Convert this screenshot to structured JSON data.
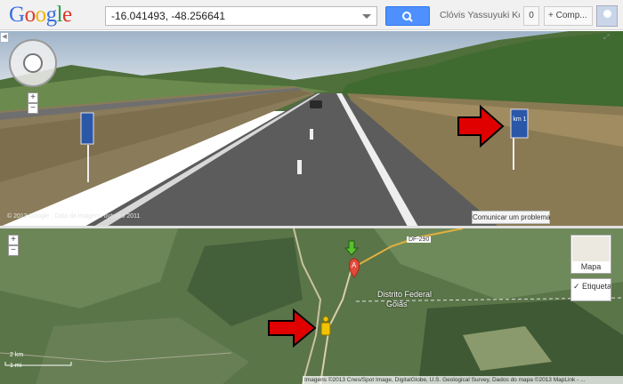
{
  "header": {
    "logo_text": "Google",
    "search_value": "-16.041493, -48.256641",
    "user_name": "Clóvis Yassuyuki Ko...",
    "notification_count": "0",
    "share_label": "+ Comp..."
  },
  "street_view": {
    "copyright": "© 2013 Google · Data da imagem: outubro 2011",
    "report_label": "Comunicar um problema",
    "sign_text": "km 1",
    "zoom_in": "+",
    "zoom_out": "−",
    "watermark": "© 2013"
  },
  "map": {
    "zoom_in": "+",
    "zoom_out": "−",
    "road_label": "DF-290",
    "marker_label": "A",
    "region_df": "Distrito Federal",
    "region_go": "Goiás",
    "map_type_label": "Mapa",
    "labels_toggle": "✓ Etiquetas",
    "scale_km": "2 km",
    "scale_mi": "1 mi",
    "attribution": "Imagens ©2013 Cnes/Spot Image, DigitalGlobe, U.S. Geological Survey, Dados do mapa ©2013 MapLink - ..."
  },
  "colors": {
    "accent": "#4d90fe",
    "arrow": "#e00000",
    "pegman": "#f2c300"
  }
}
